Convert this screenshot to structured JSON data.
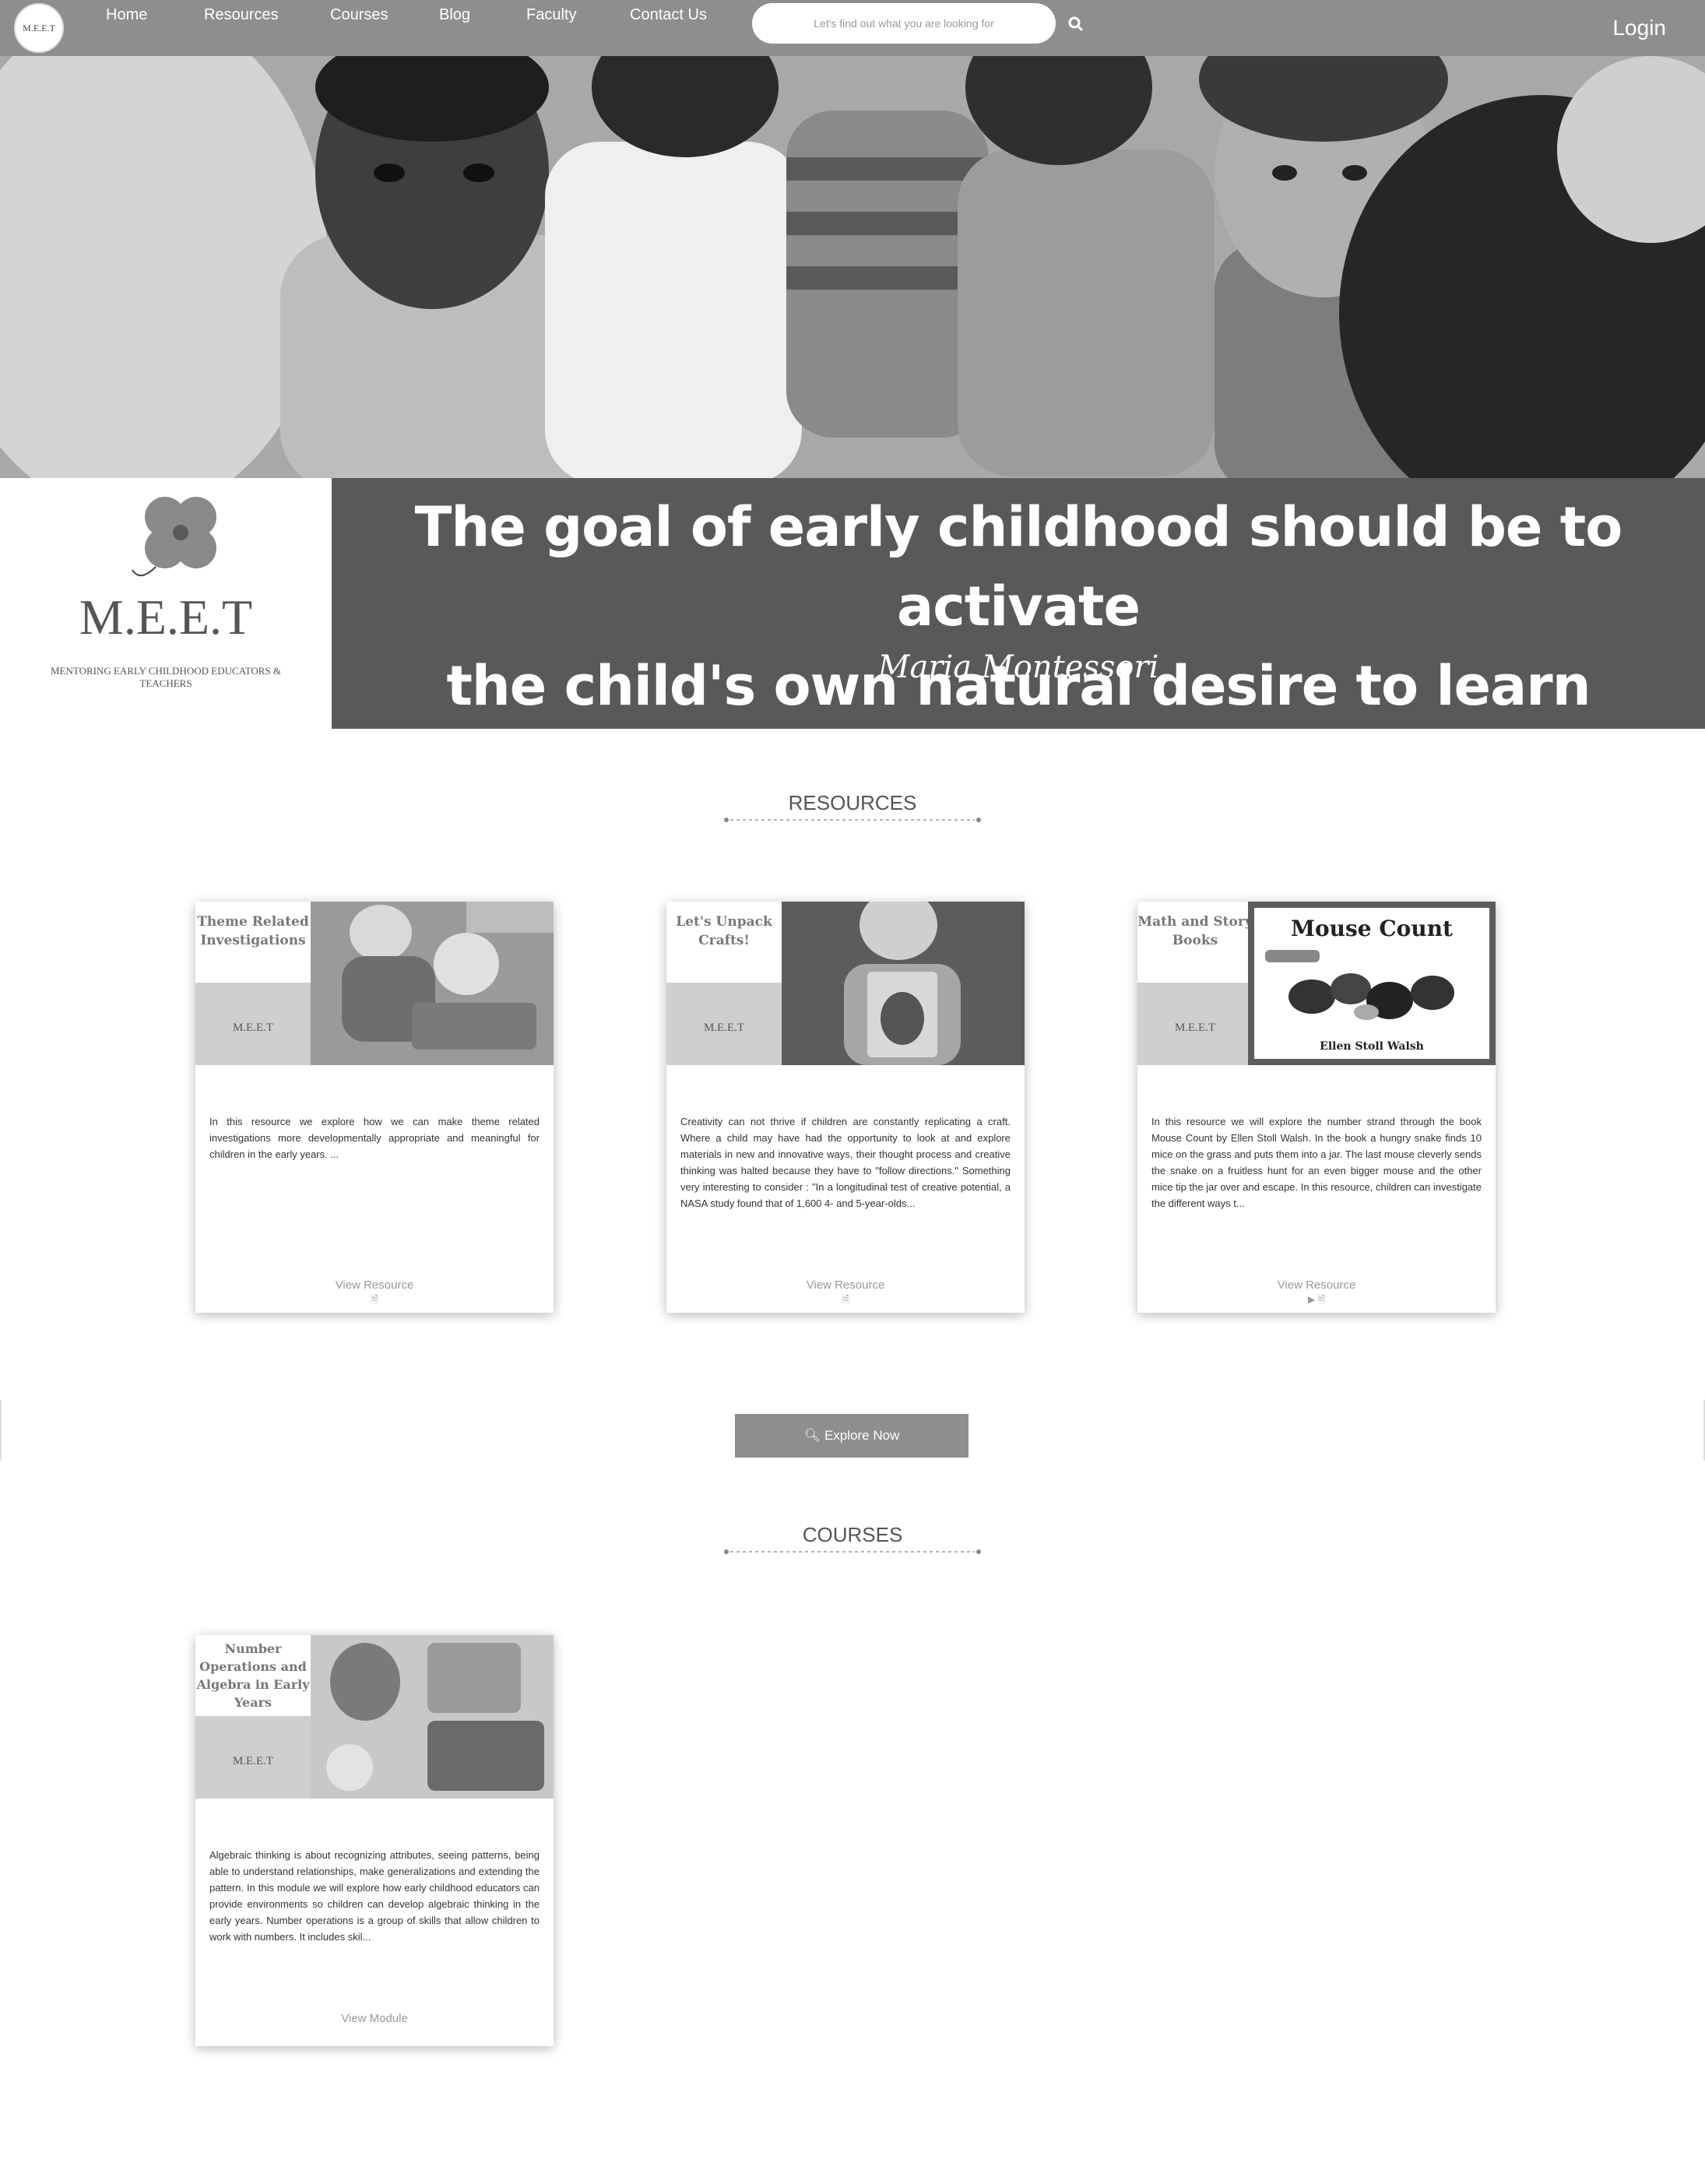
{
  "nav": {
    "logo": "M.E.E.T",
    "links": [
      "Home",
      "Resources",
      "Courses",
      "Blog",
      "Faculty",
      "Contact Us"
    ],
    "search_placeholder": "Let's find out what you are looking for",
    "login": "Login"
  },
  "hero": {
    "image": "children-listening-photo"
  },
  "brand": {
    "name": "M.E.E.T",
    "tagline": "MENTORING EARLY CHILDHOOD EDUCATORS & TEACHERS"
  },
  "quote": {
    "line1": "The goal of early childhood should be to activate",
    "line2": "the child's own natural desire to learn",
    "author": "Maria Montessori"
  },
  "resources": {
    "title": "RESOURCES",
    "cards": [
      {
        "thumb_title": "Theme Related Investigations",
        "thumb_brand": "M.E.E.T",
        "text": "In this resource we explore how we can make theme related investigations more developmentally appropriate and meaningful for children in the early years. ...",
        "link": "View Resource",
        "icons": "🗎"
      },
      {
        "thumb_title": "Let's Unpack Crafts!",
        "thumb_brand": "M.E.E.T",
        "text": "Creativity can not thrive if children are constantly replicating a craft. Where a child may have had the opportunity to look at and explore materials in new and innovative ways, their thought process and creative thinking was halted because they have to \"follow directions.\" Something very interesting to consider : \"In a longitudinal test of creative potential, a NASA study found that of 1,600 4- and 5-year-olds...",
        "link": "View Resource",
        "icons": "🗎"
      },
      {
        "thumb_title": "Math and Story Books",
        "thumb_brand": "M.E.E.T",
        "book_title": "Mouse Count",
        "book_author": "Ellen Stoll Walsh",
        "text": "In this resource we will explore the number strand through the book Mouse Count by Ellen Stoll Walsh. In the book a hungry snake finds 10 mice on the grass and puts them into a jar. The last mouse cleverly sends the snake on a fruitless hunt for an even bigger mouse and the other mice tip the jar over and escape. In this resource, children can investigate the different ways t...",
        "link": "View Resource",
        "icons": "▶ 🗎"
      }
    ],
    "explore_button": "Explore Now"
  },
  "courses": {
    "title": "COURSES",
    "cards": [
      {
        "thumb_title": "Number Operations and Algebra in Early Years",
        "thumb_brand": "M.E.E.T",
        "text": "Algebraic thinking is about recognizing attributes, seeing patterns, being able to understand relationships, make generalizations and extending the pattern. In this module we will explore how early childhood educators can provide environments so children can develop algebraic thinking in the early years.  Number operations is a group of skills that allow children to work with numbers. It includes skil...",
        "link": "View Module"
      }
    ]
  }
}
